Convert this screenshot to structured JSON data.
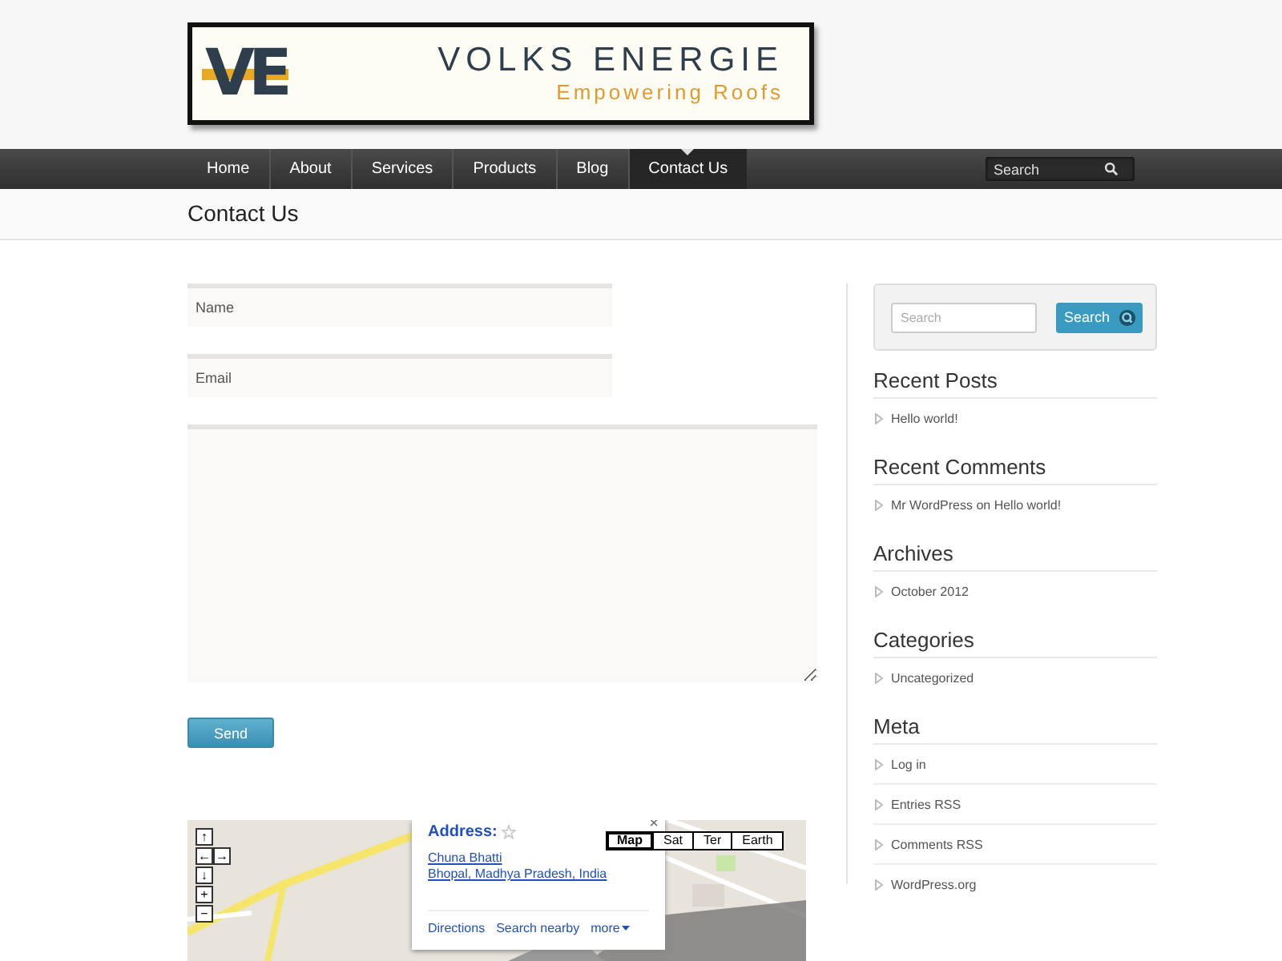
{
  "logo": {
    "mark": "VE",
    "name": "VOLKS ENERGIE",
    "tagline": "Empowering Roofs"
  },
  "nav": {
    "items": [
      {
        "label": "Home",
        "selected": false
      },
      {
        "label": "About",
        "selected": false
      },
      {
        "label": "Services",
        "selected": false
      },
      {
        "label": "Products",
        "selected": false
      },
      {
        "label": "Blog",
        "selected": false
      },
      {
        "label": "Contact Us",
        "selected": true
      }
    ],
    "search": {
      "placeholder": "Search"
    }
  },
  "page_title": "Contact Us",
  "form": {
    "fields": [
      {
        "kind": "input",
        "placeholder": "Name"
      },
      {
        "kind": "input",
        "placeholder": "Email"
      },
      {
        "kind": "textarea"
      }
    ],
    "submit": "Send"
  },
  "map": {
    "controls": [
      "↑",
      "←",
      "→",
      "↓",
      "+",
      "−"
    ],
    "map_types": [
      {
        "label": "Map",
        "selected": true
      },
      {
        "label": "Sat",
        "selected": false
      },
      {
        "label": "Ter",
        "selected": false
      },
      {
        "label": "Earth",
        "selected": false
      }
    ],
    "info": {
      "title": "Address:",
      "close": "×",
      "lines": [
        "Chuna Bhatti",
        "Bhopal, Madhya Pradesh, India"
      ],
      "links": [
        "Directions",
        "Search nearby",
        "more"
      ]
    }
  },
  "sidebar": {
    "search": {
      "placeholder": "Search",
      "button": "Search"
    },
    "widgets": [
      {
        "title": "Recent Posts",
        "items": [
          "Hello world!"
        ]
      },
      {
        "title": "Recent Comments",
        "items": [
          "Mr WordPress on Hello world!"
        ]
      },
      {
        "title": "Archives",
        "items": [
          "October 2012"
        ]
      },
      {
        "title": "Categories",
        "items": [
          "Uncategorized"
        ]
      },
      {
        "title": "Meta",
        "items": [
          "Log in",
          "Entries RSS",
          "Comments RSS",
          "WordPress.org"
        ]
      }
    ]
  }
}
